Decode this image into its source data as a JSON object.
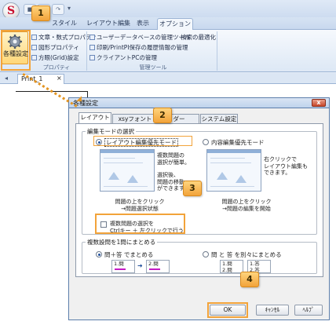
{
  "app": {
    "orb_letter": "S"
  },
  "ribbon": {
    "tabs": [
      "スタイル",
      "レイアウト編集",
      "表示",
      "オプション"
    ],
    "settings_button_label": "各種設定",
    "group1_items": [
      "文章・数式プロパティ",
      "図形プロパティ",
      "方眼(Grid)設定"
    ],
    "group1_label": "プロパティ",
    "group2_items": [
      "ユーザーデータベースの管理ツール",
      "印刷/PrintPI保存の履歴情報の管理",
      "クライアントPCの管理"
    ],
    "group2_extra": "検索の最適化",
    "group2_label": "管理ツール"
  },
  "document": {
    "tab_label": "Print_1",
    "tab_close": "×"
  },
  "dialog": {
    "title": "各種設定",
    "close": "x",
    "tabs": [
      "レイアウト",
      "xsyフォント",
      "ダー",
      "システム設定"
    ],
    "edit_mode": {
      "legend": "編集モードの選択",
      "option_layout": "レイアウト編集優先モード",
      "option_content": "内容編集優先モード",
      "layout_note": [
        "複数問題の",
        "選択が簡単。"
      ],
      "layout_note2": [
        "選択後、",
        "問題の移動",
        "ができます。"
      ],
      "content_note": [
        "右クリックで",
        "レイアウト編集も",
        "できます。"
      ],
      "layout_caption": [
        "問題の上をクリック",
        "→問題選択状態"
      ],
      "content_caption": [
        "問題の上をクリック",
        "→問題の編集を開始"
      ],
      "checkbox_label": [
        "複数問題の選択を",
        "Ctrlキー ＋ 左クリックで行う"
      ]
    },
    "merge": {
      "legend": "複数設問を1問にまとめる",
      "option_together": "問＋答 でまとめる",
      "option_separate": "問 と 答 を別々にまとめる",
      "mini_rows": [
        "1.問",
        "2.問",
        "1.答",
        "2.答"
      ]
    },
    "buttons": {
      "ok": "OK",
      "cancel": "ｷｬﾝｾﾙ",
      "help": "ﾍﾙﾌﾟ"
    }
  },
  "callouts": [
    "1",
    "2",
    "3",
    "4"
  ],
  "colors": {
    "accent": "#f2a33a",
    "ribbon": "#dde8f5",
    "magenta": "#c41ac4"
  }
}
